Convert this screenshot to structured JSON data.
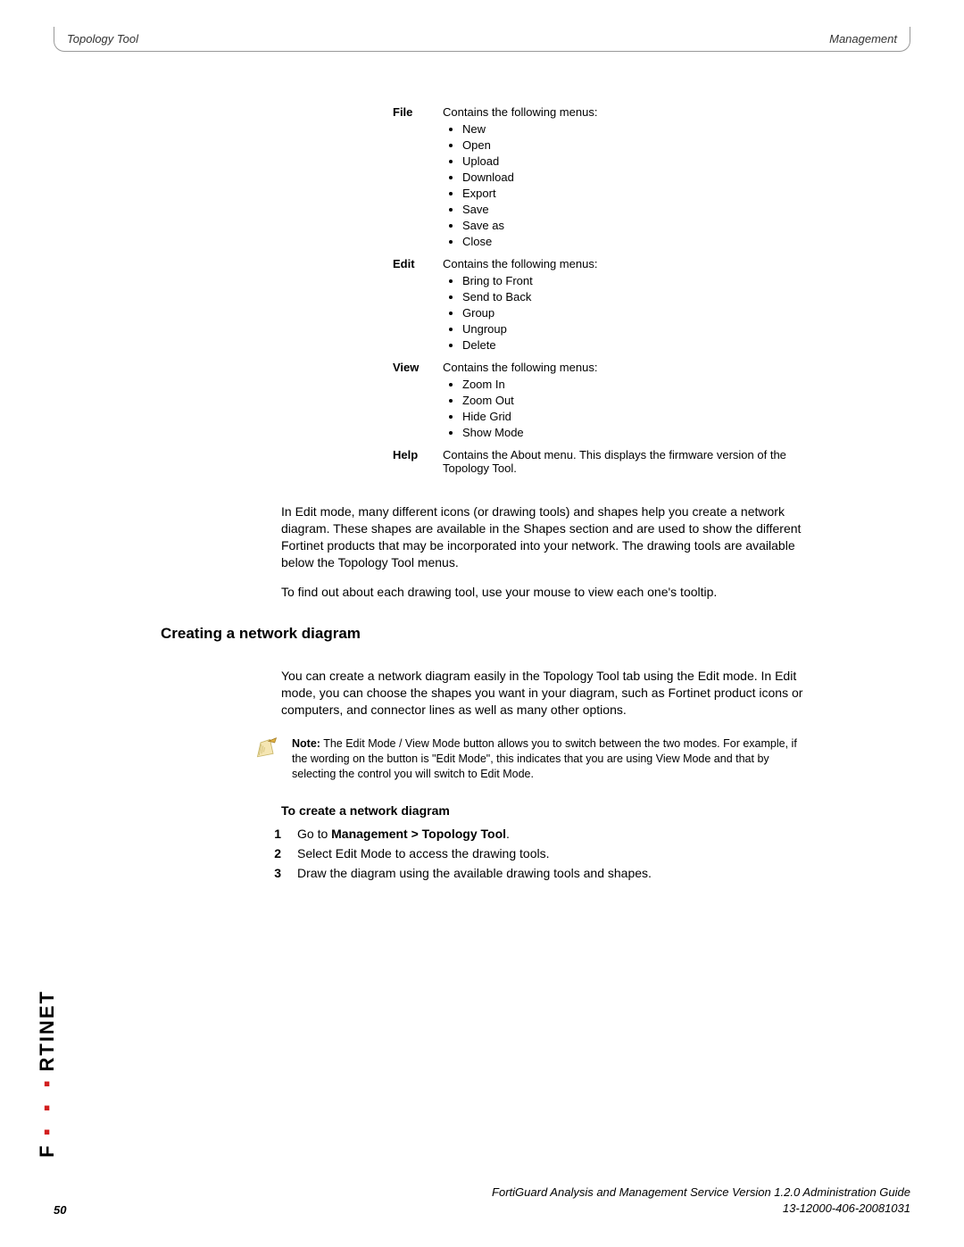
{
  "header": {
    "left": "Topology Tool",
    "right": "Management"
  },
  "menus": [
    {
      "label": "File",
      "intro": "Contains the following menus:",
      "items": [
        "New",
        "Open",
        "Upload",
        "Download",
        "Export",
        "Save",
        "Save as",
        "Close"
      ]
    },
    {
      "label": "Edit",
      "intro": "Contains the following menus:",
      "items": [
        "Bring to Front",
        "Send to Back",
        "Group",
        "Ungroup",
        "Delete"
      ]
    },
    {
      "label": "View",
      "intro": "Contains the following menus:",
      "items": [
        "Zoom In",
        "Zoom Out",
        "Hide Grid",
        "Show Mode"
      ]
    },
    {
      "label": "Help",
      "intro": "Contains the About menu. This displays the firmware version of the Topology Tool.",
      "items": []
    }
  ],
  "para1": "In Edit mode, many different icons (or drawing tools) and shapes help you create a network diagram. These shapes are available in the Shapes section and are used to show the different Fortinet products that may be incorporated into your network. The drawing tools are available below the Topology Tool menus.",
  "para2": "To find out about each drawing tool, use your mouse to view each one's tooltip.",
  "section_heading": "Creating a network diagram",
  "para3": "You can create a network diagram easily in the Topology Tool tab using the Edit mode. In Edit mode, you can choose the shapes you want in your diagram, such as Fortinet product icons or computers, and connector lines as well as many other options.",
  "note_label": "Note:",
  "note_text": " The Edit Mode / View Mode button allows you to switch between the two modes. For example, if the wording on the button is \"Edit Mode\", this indicates that you are using View Mode and that by selecting the control you will switch to Edit Mode.",
  "subheading": "To create a network diagram",
  "steps": [
    {
      "num": "1",
      "pre": "Go to ",
      "bold": "Management > Topology Tool",
      "post": "."
    },
    {
      "num": "2",
      "pre": "Select Edit Mode to access the drawing tools.",
      "bold": "",
      "post": ""
    },
    {
      "num": "3",
      "pre": "Draw the diagram using the available drawing tools and shapes.",
      "bold": "",
      "post": ""
    }
  ],
  "footer": {
    "line1": "FortiGuard Analysis and Management Service Version 1.2.0 Administration Guide",
    "line2": "13-12000-406-20081031",
    "page": "50"
  },
  "brand": {
    "p1": "F",
    "p2": "RTINET"
  }
}
